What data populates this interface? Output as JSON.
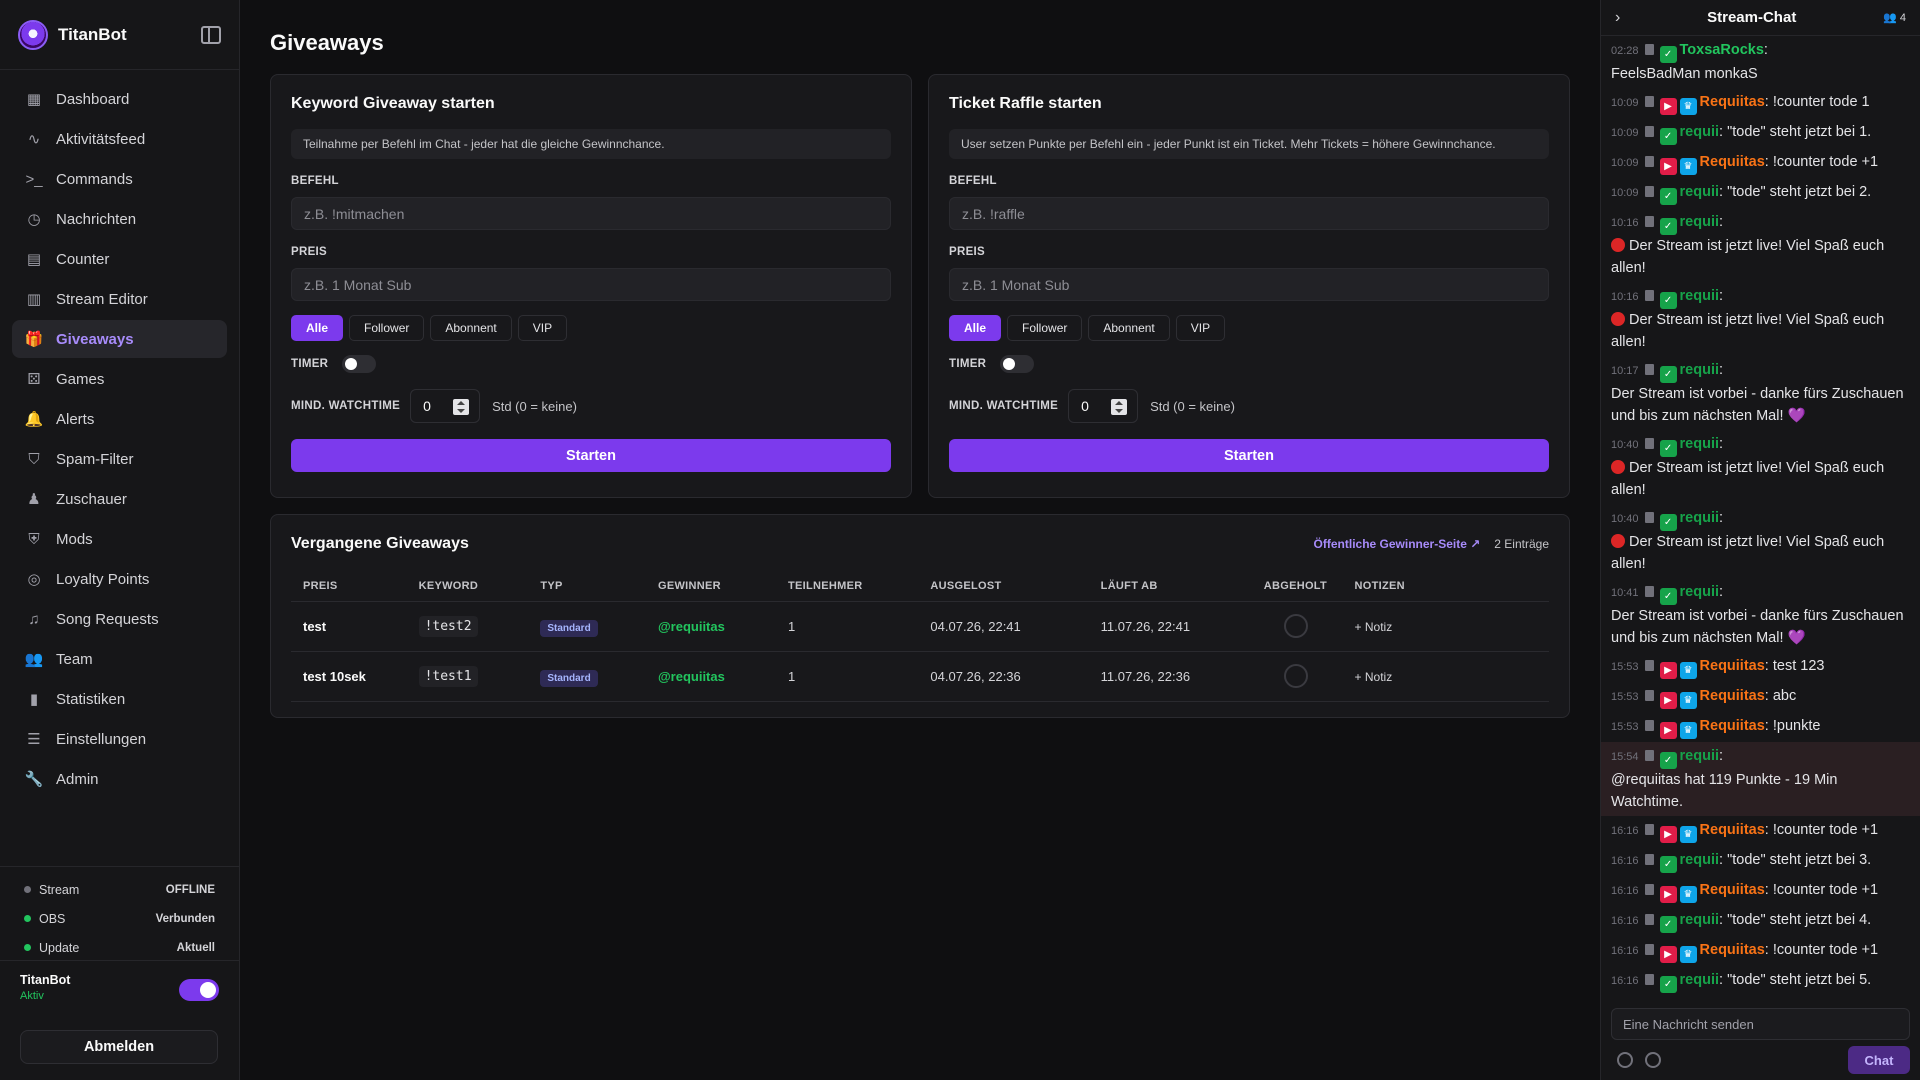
{
  "brand": {
    "name": "TitanBot"
  },
  "nav": [
    {
      "label": "Dashboard",
      "icon": "grid-icon",
      "glyph": "▦"
    },
    {
      "label": "Aktivitätsfeed",
      "icon": "activity-icon",
      "glyph": "∿"
    },
    {
      "label": "Commands",
      "icon": "terminal-icon",
      "glyph": ">_"
    },
    {
      "label": "Nachrichten",
      "icon": "clock-icon",
      "glyph": "◷"
    },
    {
      "label": "Counter",
      "icon": "calculator-icon",
      "glyph": "▤"
    },
    {
      "label": "Stream Editor",
      "icon": "layout-icon",
      "glyph": "▥"
    },
    {
      "label": "Giveaways",
      "icon": "gift-icon",
      "glyph": "🎁"
    },
    {
      "label": "Games",
      "icon": "dice-icon",
      "glyph": "⚄"
    },
    {
      "label": "Alerts",
      "icon": "bell-icon",
      "glyph": "🔔"
    },
    {
      "label": "Spam-Filter",
      "icon": "shield-icon",
      "glyph": "⛉"
    },
    {
      "label": "Zuschauer",
      "icon": "user-icon",
      "glyph": "♟"
    },
    {
      "label": "Mods",
      "icon": "shield-check-icon",
      "glyph": "⛨"
    },
    {
      "label": "Loyalty Points",
      "icon": "coins-icon",
      "glyph": "◎"
    },
    {
      "label": "Song Requests",
      "icon": "music-icon",
      "glyph": "♫"
    },
    {
      "label": "Team",
      "icon": "users-icon",
      "glyph": "👥"
    },
    {
      "label": "Statistiken",
      "icon": "bar-chart-icon",
      "glyph": "▮"
    },
    {
      "label": "Einstellungen",
      "icon": "sliders-icon",
      "glyph": "☰"
    },
    {
      "label": "Admin",
      "icon": "wrench-icon",
      "glyph": "🔧"
    }
  ],
  "status": [
    {
      "label": "Stream",
      "value": "OFFLINE",
      "color": "#71717a"
    },
    {
      "label": "OBS",
      "value": "Verbunden",
      "color": "#22c55e"
    },
    {
      "label": "Update",
      "value": "Aktuell",
      "color": "#22c55e"
    }
  ],
  "bot": {
    "name": "TitanBot",
    "status": "Aktiv"
  },
  "logout_label": "Abmelden",
  "page_title": "Giveaways",
  "keyword_card": {
    "title": "Keyword Giveaway starten",
    "desc": "Teilnahme per Befehl im Chat - jeder hat die gleiche Gewinnchance.",
    "befehl_label": "BEFEHL",
    "befehl_placeholder": "z.B. !mitmachen",
    "preis_label": "PREIS",
    "preis_placeholder": "z.B. 1 Monat Sub",
    "filters": [
      "Alle",
      "Follower",
      "Abonnent",
      "VIP"
    ],
    "timer_label": "TIMER",
    "watch_label": "MIND. WATCHTIME",
    "watch_value": "0",
    "watch_hint": "Std (0 = keine)",
    "start_label": "Starten"
  },
  "raffle_card": {
    "title": "Ticket Raffle starten",
    "desc": "User setzen Punkte per Befehl ein - jeder Punkt ist ein Ticket. Mehr Tickets = höhere Gewinnchance.",
    "befehl_label": "BEFEHL",
    "befehl_placeholder": "z.B. !raffle",
    "preis_label": "PREIS",
    "preis_placeholder": "z.B. 1 Monat Sub",
    "filters": [
      "Alle",
      "Follower",
      "Abonnent",
      "VIP"
    ],
    "timer_label": "TIMER",
    "watch_label": "MIND. WATCHTIME",
    "watch_value": "0",
    "watch_hint": "Std (0 = keine)",
    "start_label": "Starten"
  },
  "past": {
    "title": "Vergangene Giveaways",
    "link": "Öffentliche Gewinner-Seite ↗",
    "entries": "2 Einträge",
    "columns": [
      "PREIS",
      "KEYWORD",
      "TYP",
      "GEWINNER",
      "TEILNEHMER",
      "AUSGELOST",
      "LÄUFT AB",
      "ABGEHOLT",
      "NOTIZEN"
    ],
    "rows": [
      {
        "preis": "test",
        "keyword": "!test2",
        "typ": "Standard",
        "gewinner": "@requiitas",
        "teilnehmer": "1",
        "ausgelost": "04.07.26, 22:41",
        "laeuft_ab": "11.07.26, 22:41",
        "notiz": "+ Notiz"
      },
      {
        "preis": "test 10sek",
        "keyword": "!test1",
        "typ": "Standard",
        "gewinner": "@requiitas",
        "teilnehmer": "1",
        "ausgelost": "04.07.26, 22:36",
        "laeuft_ab": "11.07.26, 22:36",
        "notiz": "+ Notiz"
      }
    ]
  },
  "chat": {
    "title": "Stream-Chat",
    "viewers": "4",
    "input_placeholder": "Eine Nachricht senden",
    "send_label": "Chat",
    "messages": [
      {
        "ts": "02:28",
        "user": "ToxsaRocks",
        "ucolor": "u-green2",
        "badges": [
          "green"
        ],
        "text": "",
        "line2": "FeelsBadMan monkaS"
      },
      {
        "ts": "10:09",
        "user": "Requiitas",
        "ucolor": "u-red",
        "badges": [
          "red",
          "blue"
        ],
        "text": "!counter tode 1"
      },
      {
        "ts": "10:09",
        "user": "requii",
        "ucolor": "u-green",
        "badges": [
          "green"
        ],
        "text": "\"tode\" steht jetzt bei 1."
      },
      {
        "ts": "10:09",
        "user": "Requiitas",
        "ucolor": "u-red",
        "badges": [
          "red",
          "blue"
        ],
        "text": "!counter tode +1"
      },
      {
        "ts": "10:09",
        "user": "requii",
        "ucolor": "u-green",
        "badges": [
          "green"
        ],
        "text": "\"tode\" steht jetzt bei 2."
      },
      {
        "ts": "10:16",
        "user": "requii",
        "ucolor": "u-green",
        "badges": [
          "green"
        ],
        "text": "",
        "live": true,
        "line2": "Der Stream ist jetzt live! Viel Spaß euch allen!"
      },
      {
        "ts": "10:16",
        "user": "requii",
        "ucolor": "u-green",
        "badges": [
          "green"
        ],
        "text": "",
        "live": true,
        "line2": "Der Stream ist jetzt live! Viel Spaß euch allen!"
      },
      {
        "ts": "10:17",
        "user": "requii",
        "ucolor": "u-green",
        "badges": [
          "green"
        ],
        "text": "",
        "line2": "Der Stream ist vorbei - danke fürs Zuschauen und bis zum nächsten Mal! 💜"
      },
      {
        "ts": "10:40",
        "user": "requii",
        "ucolor": "u-green",
        "badges": [
          "green"
        ],
        "text": "",
        "live": true,
        "line2": "Der Stream ist jetzt live! Viel Spaß euch allen!"
      },
      {
        "ts": "10:40",
        "user": "requii",
        "ucolor": "u-green",
        "badges": [
          "green"
        ],
        "text": "",
        "live": true,
        "line2": "Der Stream ist jetzt live! Viel Spaß euch allen!"
      },
      {
        "ts": "10:41",
        "user": "requii",
        "ucolor": "u-green",
        "badges": [
          "green"
        ],
        "text": "",
        "line2": "Der Stream ist vorbei - danke fürs Zuschauen und bis zum nächsten Mal! 💜"
      },
      {
        "ts": "15:53",
        "user": "Requiitas",
        "ucolor": "u-red",
        "badges": [
          "red",
          "blue"
        ],
        "text": "test 123"
      },
      {
        "ts": "15:53",
        "user": "Requiitas",
        "ucolor": "u-red",
        "badges": [
          "red",
          "blue"
        ],
        "text": "abc"
      },
      {
        "ts": "15:53",
        "user": "Requiitas",
        "ucolor": "u-red",
        "badges": [
          "red",
          "blue"
        ],
        "text": "!punkte"
      },
      {
        "ts": "15:54",
        "user": "requii",
        "ucolor": "u-green",
        "badges": [
          "green"
        ],
        "text": "",
        "hl": true,
        "line2": "@requiitas hat 119 Punkte - 19 Min Watchtime."
      },
      {
        "ts": "16:16",
        "user": "Requiitas",
        "ucolor": "u-red",
        "badges": [
          "red",
          "blue"
        ],
        "text": "!counter tode +1"
      },
      {
        "ts": "16:16",
        "user": "requii",
        "ucolor": "u-green",
        "badges": [
          "green"
        ],
        "text": "\"tode\" steht jetzt bei 3."
      },
      {
        "ts": "16:16",
        "user": "Requiitas",
        "ucolor": "u-red",
        "badges": [
          "red",
          "blue"
        ],
        "text": "!counter tode +1"
      },
      {
        "ts": "16:16",
        "user": "requii",
        "ucolor": "u-green",
        "badges": [
          "green"
        ],
        "text": "\"tode\" steht jetzt bei 4."
      },
      {
        "ts": "16:16",
        "user": "Requiitas",
        "ucolor": "u-red",
        "badges": [
          "red",
          "blue"
        ],
        "text": "!counter tode +1"
      },
      {
        "ts": "16:16",
        "user": "requii",
        "ucolor": "u-green",
        "badges": [
          "green"
        ],
        "text": "\"tode\" steht jetzt bei 5."
      }
    ]
  }
}
